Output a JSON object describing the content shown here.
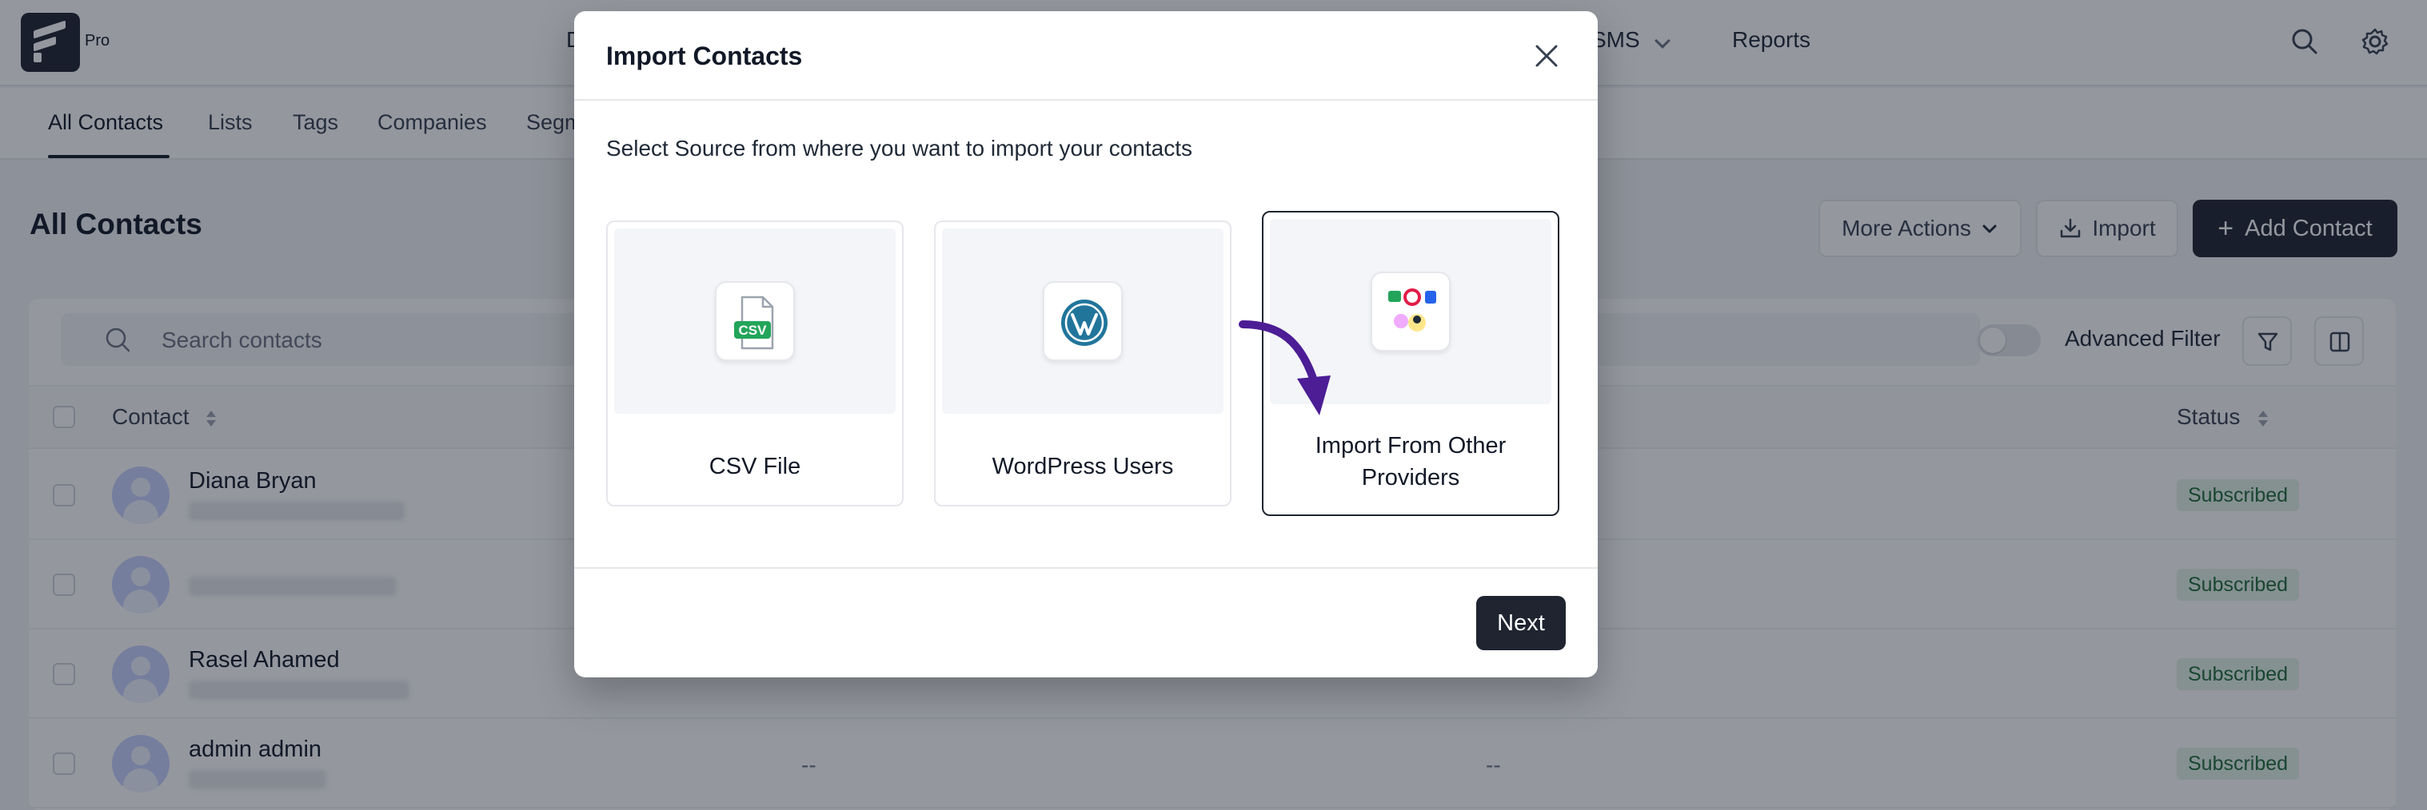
{
  "app": {
    "badge": "Pro",
    "nav": [
      {
        "label": "D"
      },
      {
        "label": "SMS"
      },
      {
        "label": "Reports"
      }
    ]
  },
  "subnav": {
    "items": [
      {
        "label": "All Contacts"
      },
      {
        "label": "Lists"
      },
      {
        "label": "Tags"
      },
      {
        "label": "Companies"
      },
      {
        "label": "Segm"
      }
    ]
  },
  "page": {
    "title": "All Contacts",
    "more_actions": "More Actions",
    "import": "Import",
    "add_contact": "Add Contact"
  },
  "filters": {
    "search_placeholder": "Search contacts",
    "advanced_filter": "Advanced Filter"
  },
  "table": {
    "columns": {
      "contact": "Contact",
      "status": "Status"
    },
    "rows": [
      {
        "name": "Diana Bryan",
        "col2": "",
        "col3": "",
        "status": "Subscribed"
      },
      {
        "name": "",
        "col2": "",
        "col3": "",
        "status": "Subscribed"
      },
      {
        "name": "Rasel Ahamed",
        "col2": "",
        "col3": "",
        "status": "Subscribed"
      },
      {
        "name": "admin admin",
        "col2": "--",
        "col3": "--",
        "status": "Subscribed"
      }
    ]
  },
  "modal": {
    "title": "Import Contacts",
    "subtitle": "Select Source from where you want to import your contacts",
    "sources": [
      {
        "label": "CSV File",
        "icon": "csv-file-icon",
        "icon_text": "CSV"
      },
      {
        "label": "WordPress Users",
        "icon": "wordpress-icon"
      },
      {
        "label": "Import From Other Providers",
        "label_line1": "Import From Other",
        "label_line2": "Providers",
        "icon": "providers-icon",
        "selected": true
      }
    ],
    "next_label": "Next"
  },
  "colors": {
    "dark": "#1f2430",
    "accent_arrow": "#4c1d95",
    "csv_green": "#22a55a",
    "wordpress_blue": "#21759b",
    "badge_bg": "#e3f4e8",
    "badge_text": "#1f6b3a"
  }
}
